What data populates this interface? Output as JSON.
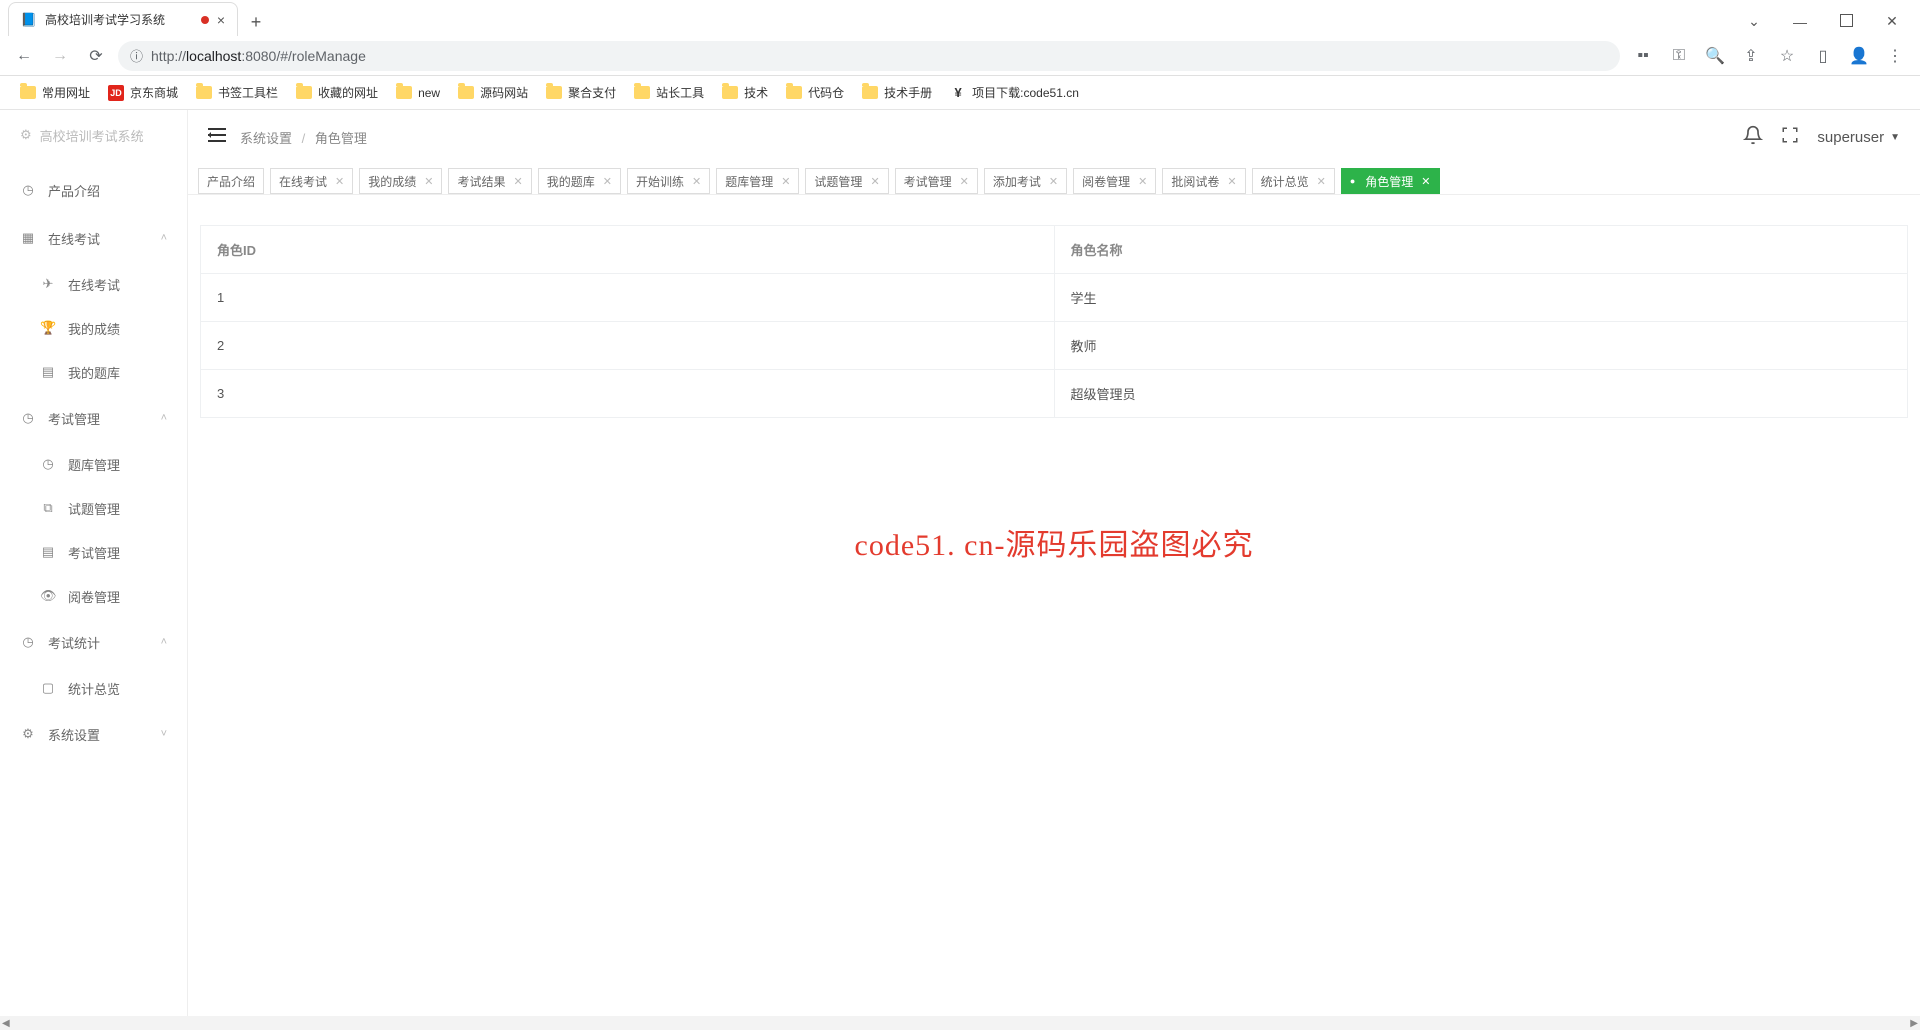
{
  "browser": {
    "tab_title": "高校培训考试学习系统",
    "url_info_icon": "ⓘ",
    "url": "http://localhost:8080/#/roleManage",
    "bookmarks": [
      {
        "label": "常用网址",
        "type": "folder"
      },
      {
        "label": "京东商城",
        "type": "jd"
      },
      {
        "label": "书签工具栏",
        "type": "folder"
      },
      {
        "label": "收藏的网址",
        "type": "folder"
      },
      {
        "label": "new",
        "type": "folder"
      },
      {
        "label": "源码网站",
        "type": "folder"
      },
      {
        "label": "聚合支付",
        "type": "folder"
      },
      {
        "label": "站长工具",
        "type": "folder"
      },
      {
        "label": "技术",
        "type": "folder"
      },
      {
        "label": "代码仓",
        "type": "folder"
      },
      {
        "label": "技术手册",
        "type": "folder"
      },
      {
        "label": "项目下载:code51.cn",
        "type": "custom"
      }
    ]
  },
  "sidebar": {
    "brand": "高校培训考试系统",
    "items": [
      {
        "icon": "◷",
        "label": "产品介绍",
        "expandable": false
      },
      {
        "icon": "▦",
        "label": "在线考试",
        "expandable": true,
        "expanded": true,
        "children": [
          {
            "icon": "✈",
            "label": "在线考试"
          },
          {
            "icon": "🏆",
            "label": "我的成绩"
          },
          {
            "icon": "▤",
            "label": "我的题库"
          }
        ]
      },
      {
        "icon": "◷",
        "label": "考试管理",
        "expandable": true,
        "expanded": true,
        "children": [
          {
            "icon": "◷",
            "label": "题库管理"
          },
          {
            "icon": "⧉",
            "label": "试题管理"
          },
          {
            "icon": "▤",
            "label": "考试管理"
          },
          {
            "icon": "👁",
            "label": "阅卷管理"
          }
        ]
      },
      {
        "icon": "◷",
        "label": "考试统计",
        "expandable": true,
        "expanded": true,
        "children": [
          {
            "icon": "▢",
            "label": "统计总览"
          }
        ]
      },
      {
        "icon": "⚙",
        "label": "系统设置",
        "expandable": true,
        "expanded": false
      }
    ]
  },
  "header": {
    "breadcrumb_parent": "系统设置",
    "breadcrumb_current": "角色管理",
    "username": "superuser"
  },
  "tabs": [
    {
      "label": "产品介绍",
      "closable": false,
      "active": false
    },
    {
      "label": "在线考试",
      "closable": true,
      "active": false
    },
    {
      "label": "我的成绩",
      "closable": true,
      "active": false
    },
    {
      "label": "考试结果",
      "closable": true,
      "active": false
    },
    {
      "label": "我的题库",
      "closable": true,
      "active": false
    },
    {
      "label": "开始训练",
      "closable": true,
      "active": false
    },
    {
      "label": "题库管理",
      "closable": true,
      "active": false
    },
    {
      "label": "试题管理",
      "closable": true,
      "active": false
    },
    {
      "label": "考试管理",
      "closable": true,
      "active": false
    },
    {
      "label": "添加考试",
      "closable": true,
      "active": false
    },
    {
      "label": "阅卷管理",
      "closable": true,
      "active": false
    },
    {
      "label": "批阅试卷",
      "closable": true,
      "active": false
    },
    {
      "label": "统计总览",
      "closable": true,
      "active": false
    },
    {
      "label": "角色管理",
      "closable": true,
      "active": true
    }
  ],
  "table": {
    "columns": [
      "角色ID",
      "角色名称"
    ],
    "rows": [
      {
        "id": "1",
        "name": "学生"
      },
      {
        "id": "2",
        "name": "教师"
      },
      {
        "id": "3",
        "name": "超级管理员"
      }
    ]
  },
  "watermark": "code51. cn-源码乐园盗图必究"
}
